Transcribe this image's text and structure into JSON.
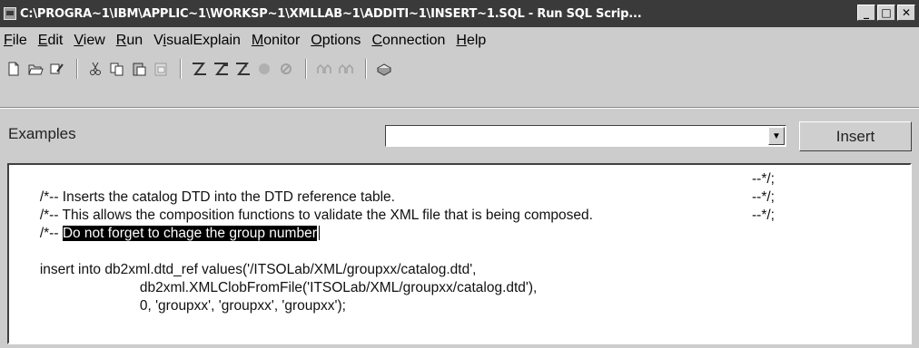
{
  "window": {
    "title": "C:\\PROGRA~1\\IBM\\APPLIC~1\\WORKSP~1\\XMLLAB~1\\ADDITI~1\\INSERT~1.SQL - Run SQL Scrip...",
    "buttons": {
      "minimize": "_",
      "maximize": "□",
      "close": "✕"
    }
  },
  "menu": {
    "items": [
      {
        "label": "File",
        "mnemonic": "F"
      },
      {
        "label": "Edit",
        "mnemonic": "E"
      },
      {
        "label": "View",
        "mnemonic": "V"
      },
      {
        "label": "Run",
        "mnemonic": "R"
      },
      {
        "label": "VisualExplain",
        "mnemonic": "i"
      },
      {
        "label": "Monitor",
        "mnemonic": "M"
      },
      {
        "label": "Options",
        "mnemonic": "O"
      },
      {
        "label": "Connection",
        "mnemonic": "C"
      },
      {
        "label": "Help",
        "mnemonic": "H"
      }
    ]
  },
  "toolbar": {
    "icons": [
      "new-file-icon",
      "open-file-icon",
      "save-file-icon",
      "cut-icon",
      "copy-icon",
      "paste-icon",
      "paste-disabled-icon",
      "run-all-icon",
      "run-selected-icon",
      "run-from-cursor-icon",
      "stop-icon",
      "cancel-icon",
      "explain-icon",
      "explain-selected-icon",
      "print-icon"
    ]
  },
  "examples": {
    "label": "Examples",
    "value": "",
    "insert_label": "Insert"
  },
  "editor": {
    "lines": [
      {
        "text": "/*-- Inserts the catalog DTD into the DTD reference table.",
        "end": "--*/;"
      },
      {
        "text": "/*-- This allows the composition functions to validate the XML file that is being composed.",
        "end": "--*/;"
      },
      {
        "prefix": "/*-- ",
        "highlight": "Do not forget to chage the group number",
        "end": "--*/;"
      },
      {
        "text": ""
      },
      {
        "text": "insert into db2xml.dtd_ref values('/ITSOLab/XML/groupxx/catalog.dtd',"
      },
      {
        "text": "db2xml.XMLClobFromFile('ITSOLab/XML/groupxx/catalog.dtd'),",
        "indent": true
      },
      {
        "text": "0, 'groupxx', 'groupxx', 'groupxx');",
        "indent": true
      }
    ]
  }
}
